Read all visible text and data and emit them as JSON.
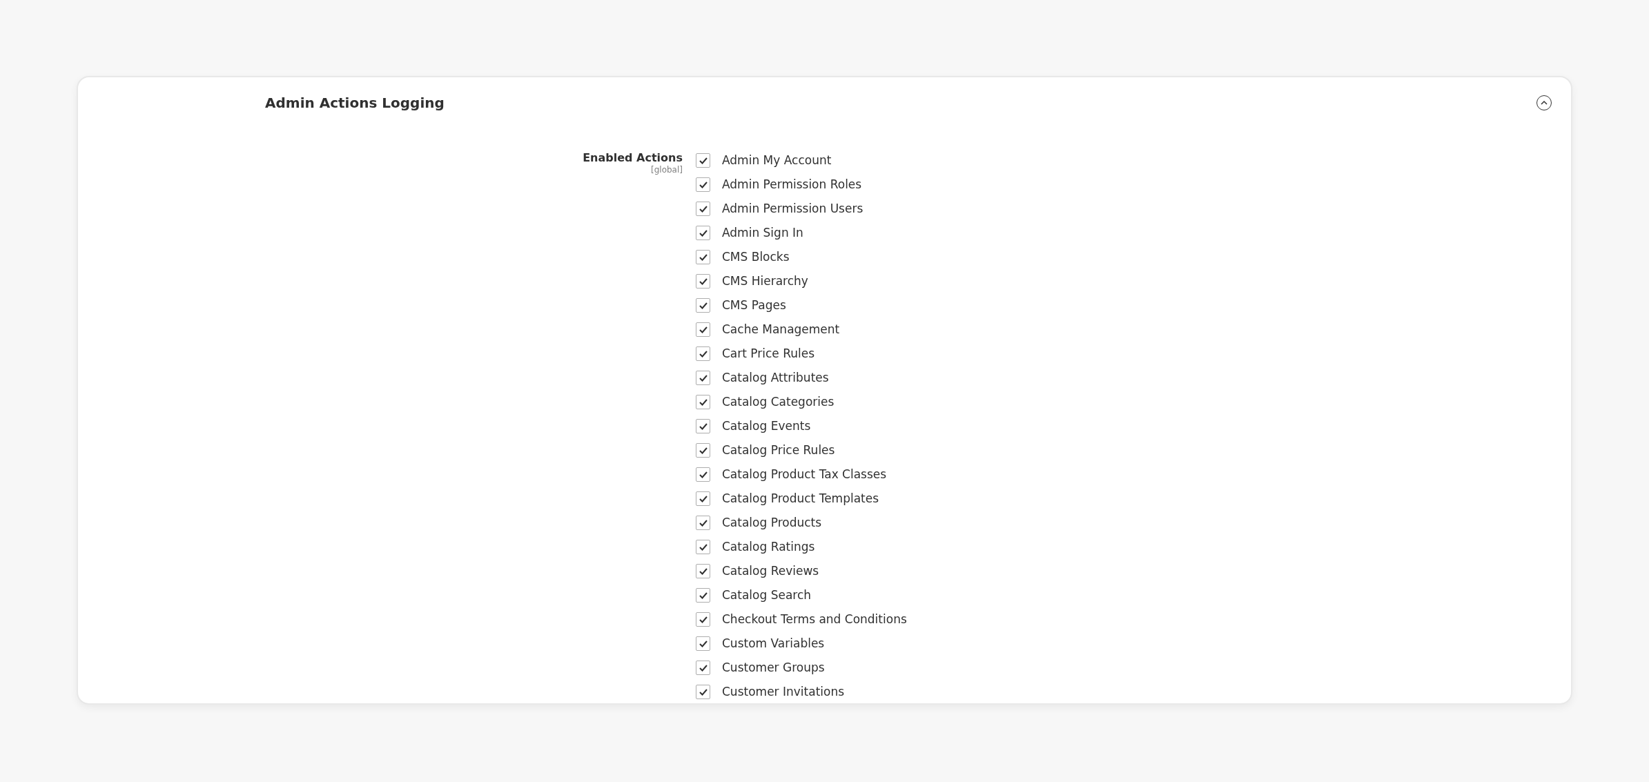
{
  "section": {
    "title": "Admin Actions Logging",
    "expanded": true
  },
  "field": {
    "label": "Enabled Actions",
    "scope": "[global]"
  },
  "actions": [
    {
      "label": "Admin My Account",
      "checked": true
    },
    {
      "label": "Admin Permission Roles",
      "checked": true
    },
    {
      "label": "Admin Permission Users",
      "checked": true
    },
    {
      "label": "Admin Sign In",
      "checked": true
    },
    {
      "label": "CMS Blocks",
      "checked": true
    },
    {
      "label": "CMS Hierarchy",
      "checked": true
    },
    {
      "label": "CMS Pages",
      "checked": true
    },
    {
      "label": "Cache Management",
      "checked": true
    },
    {
      "label": "Cart Price Rules",
      "checked": true
    },
    {
      "label": "Catalog Attributes",
      "checked": true
    },
    {
      "label": "Catalog Categories",
      "checked": true
    },
    {
      "label": "Catalog Events",
      "checked": true
    },
    {
      "label": "Catalog Price Rules",
      "checked": true
    },
    {
      "label": "Catalog Product Tax Classes",
      "checked": true
    },
    {
      "label": "Catalog Product Templates",
      "checked": true
    },
    {
      "label": "Catalog Products",
      "checked": true
    },
    {
      "label": "Catalog Ratings",
      "checked": true
    },
    {
      "label": "Catalog Reviews",
      "checked": true
    },
    {
      "label": "Catalog Search",
      "checked": true
    },
    {
      "label": "Checkout Terms and Conditions",
      "checked": true
    },
    {
      "label": "Custom Variables",
      "checked": true
    },
    {
      "label": "Customer Groups",
      "checked": true
    },
    {
      "label": "Customer Invitations",
      "checked": true
    }
  ]
}
